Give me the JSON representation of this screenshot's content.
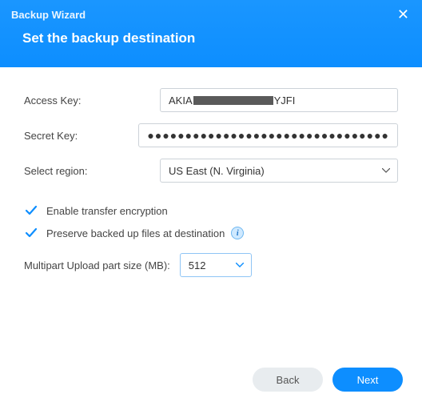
{
  "header": {
    "wizard_title": "Backup Wizard",
    "step_title": "Set the backup destination"
  },
  "form": {
    "access_key_label": "Access Key:",
    "access_key_prefix": "AKIA",
    "access_key_suffix": "YJFI",
    "secret_key_label": "Secret Key:",
    "secret_key_value": "●●●●●●●●●●●●●●●●●●●●●●●●●●●●●●●●",
    "region_label": "Select region:",
    "region_value": "US East (N. Virginia)"
  },
  "options": {
    "encrypt_label": "Enable transfer encryption",
    "encrypt_checked": true,
    "preserve_label": "Preserve backed up files at destination",
    "preserve_checked": true,
    "multipart_label": "Multipart Upload part size (MB):",
    "multipart_value": "512"
  },
  "footer": {
    "back_label": "Back",
    "next_label": "Next"
  },
  "colors": {
    "primary": "#0d8eff",
    "check": "#0d8eff"
  }
}
